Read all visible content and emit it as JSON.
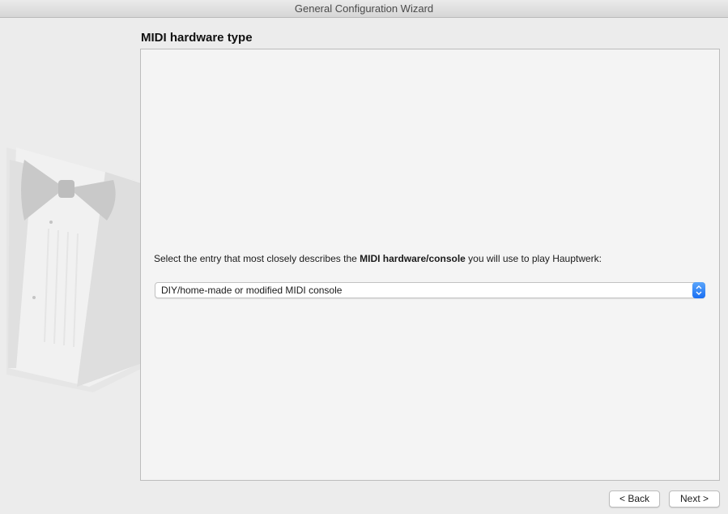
{
  "window": {
    "title": "General Configuration Wizard"
  },
  "page": {
    "title": "MIDI hardware type",
    "instruction_prefix": "Select the entry that most closely describes the ",
    "instruction_bold": "MIDI hardware/console",
    "instruction_suffix": " you will use to play Hauptwerk:"
  },
  "hardware_select": {
    "selected_value": "DIY/home-made or modified MIDI console",
    "stepper_icon": "updown-chevrons-icon",
    "accent_color": "#1a6ff3"
  },
  "sidebar": {
    "illustration_icon": "tuxedo-bowtie-icon"
  },
  "footer": {
    "back_label": "< Back",
    "next_label": "Next >"
  }
}
